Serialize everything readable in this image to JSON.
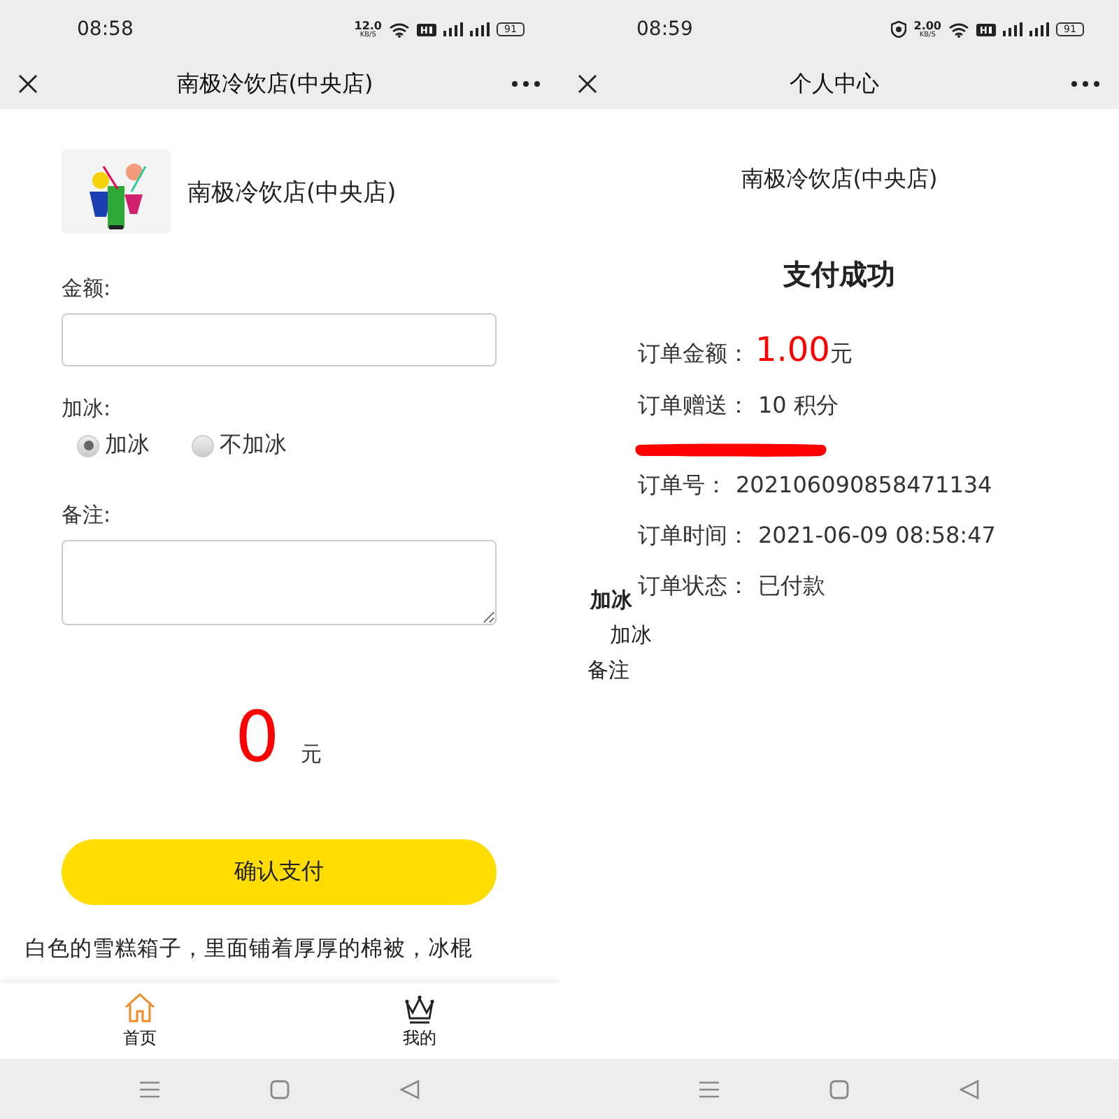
{
  "screens": [
    {
      "kind": "payment_form",
      "status_bar": {
        "time": "08:58",
        "shield": false,
        "speed": "12.0",
        "speed_unit": "KB/S",
        "battery": "91"
      },
      "nav": {
        "title": "南极冷饮店(中央店)"
      },
      "shop": {
        "name": "南极冷饮店(中央店)"
      },
      "amount_field": {
        "label": "金额:"
      },
      "ice": {
        "label": "加冰:",
        "options": [
          {
            "label": "加冰",
            "selected": true
          },
          {
            "label": "不加冰",
            "selected": false
          }
        ]
      },
      "note_field": {
        "label": "备注:"
      },
      "total": {
        "value": "0",
        "unit": "元"
      },
      "pay_button": "确认支付",
      "description": [
        "白色的雪糕箱子，里面铺着厚厚的棉被，冰棍"
      ],
      "tabs": [
        {
          "label": "首页",
          "selected": true
        },
        {
          "label": "我的",
          "selected": false
        }
      ]
    },
    {
      "kind": "order_result",
      "status_bar": {
        "time": "08:59",
        "shield": true,
        "speed": "2.00",
        "speed_unit": "KB/S",
        "battery": "91"
      },
      "nav": {
        "title": "个人中心"
      },
      "shop_name": "南极冷饮店(中央店)",
      "result_title": "支付成功",
      "amount": {
        "label": "订单金额：",
        "value": "1.00",
        "unit": "元"
      },
      "rows_top": [
        {
          "label": "订单赠送：",
          "value": "10 积分"
        }
      ],
      "rows": [
        {
          "label": "订单号：",
          "value": "202106090858471134"
        },
        {
          "label": "订单时间：",
          "value": "2021-06-09 08:58:47"
        },
        {
          "label": "订单状态：",
          "value": "已付款"
        }
      ],
      "stray_texts": [
        "加冰",
        "加冰",
        "备注"
      ]
    }
  ]
}
